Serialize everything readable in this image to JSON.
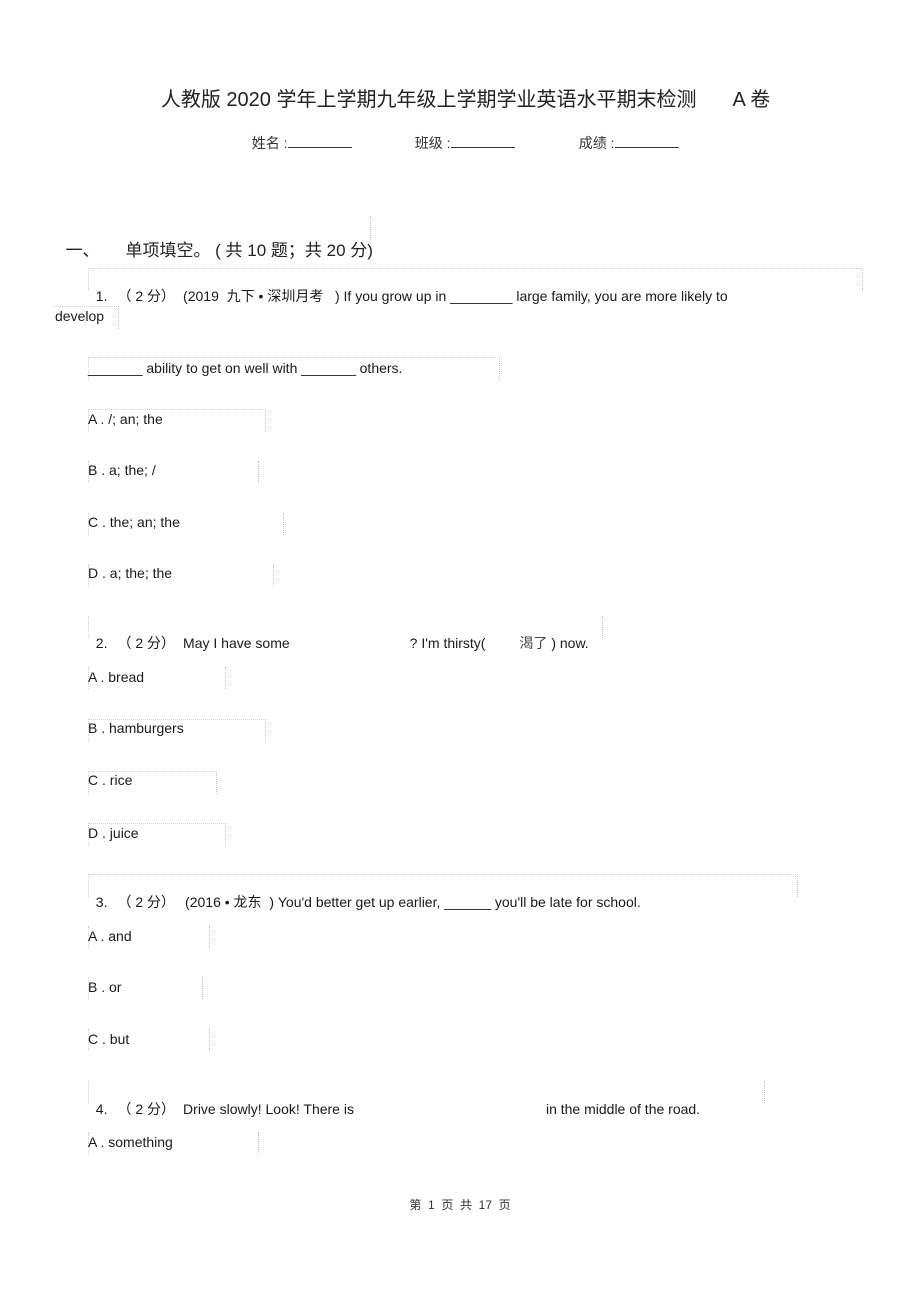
{
  "header": {
    "title": "人教版 2020 学年上学期九年级上学期学业英语水平期末检测",
    "title_suffix": "A 卷",
    "fields": [
      {
        "label": "姓名 :",
        "value": "________"
      },
      {
        "label": "班级 :",
        "value": "________"
      },
      {
        "label": "成绩 :",
        "value": "________"
      }
    ]
  },
  "section": {
    "number": "一、",
    "title": "单项填空。 ( 共 10 题；共 20 分)"
  },
  "questions": [
    {
      "number": "1.",
      "score": "（ 2 分）",
      "source": "(2019  九下 • 深圳月考   )",
      "stem_line1": "If you grow up in ________ large family, you are more likely to",
      "stem_line2": "develop",
      "stem_line3": "_______ ability to get on well with _______ others.",
      "options": [
        {
          "letter": "A",
          "text": "/; an; the"
        },
        {
          "letter": "B",
          "text": "a; the; /"
        },
        {
          "letter": "C",
          "text": "the; an; the"
        },
        {
          "letter": "D",
          "text": "a; the; the"
        }
      ]
    },
    {
      "number": "2.",
      "score": "（ 2 分）",
      "stem_part1": "May I have some",
      "stem_part2": "? I'm thirsty(",
      "stem_part3": "渴了",
      "stem_part4": ") now.",
      "options": [
        {
          "letter": "A",
          "text": "bread"
        },
        {
          "letter": "B",
          "text": "hamburgers"
        },
        {
          "letter": "C",
          "text": "rice"
        },
        {
          "letter": "D",
          "text": "juice"
        }
      ]
    },
    {
      "number": "3.",
      "score": "（ 2 分）",
      "source": "(2016 • 龙东  )",
      "stem": "You'd better get up earlier, ______ you'll be late for school.",
      "options": [
        {
          "letter": "A",
          "text": "and"
        },
        {
          "letter": "B",
          "text": "or"
        },
        {
          "letter": "C",
          "text": "but"
        }
      ]
    },
    {
      "number": "4.",
      "score": "（ 2 分）",
      "stem_part1": "Drive slowly! Look! There is",
      "stem_part2": "in the middle of the road.",
      "options": [
        {
          "letter": "A",
          "text": "something"
        }
      ]
    }
  ],
  "footer": {
    "text": "第  1  页  共  17  页"
  }
}
